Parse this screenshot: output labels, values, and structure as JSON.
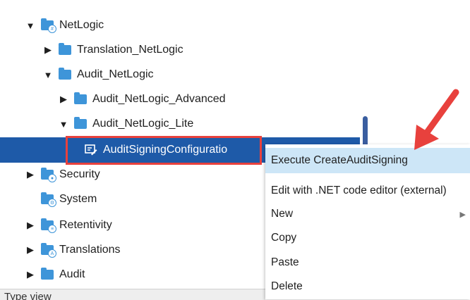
{
  "tree": {
    "items": [
      {
        "label": "NetLogic",
        "icon": "netlogic-folder-icon",
        "expander": "expanded"
      },
      {
        "label": "Translation_NetLogic",
        "icon": "folder-icon",
        "expander": "collapsed"
      },
      {
        "label": "Audit_NetLogic",
        "icon": "folder-icon",
        "expander": "expanded"
      },
      {
        "label": "Audit_NetLogic_Advanced",
        "icon": "folder-icon",
        "expander": "collapsed"
      },
      {
        "label": "Audit_NetLogic_Lite",
        "icon": "folder-icon",
        "expander": "expanded"
      },
      {
        "label": "AuditSigningConfiguratio",
        "icon": "script-icon",
        "selected": true
      },
      {
        "label": "Security",
        "icon": "security-folder-icon",
        "expander": "collapsed"
      },
      {
        "label": "System",
        "icon": "system-folder-icon"
      },
      {
        "label": "Retentivity",
        "icon": "retentivity-folder-icon",
        "expander": "collapsed"
      },
      {
        "label": "Translations",
        "icon": "translations-folder-icon",
        "expander": "collapsed"
      },
      {
        "label": "Audit",
        "icon": "folder-icon",
        "expander": "collapsed"
      }
    ]
  },
  "context_menu": {
    "items": [
      {
        "label": "Execute CreateAuditSigning",
        "highlighted": true
      },
      {
        "label": "Edit with .NET code editor (external)"
      },
      {
        "label": "New",
        "has_submenu": true
      },
      {
        "label": "Copy"
      },
      {
        "label": "Paste"
      },
      {
        "label": "Delete"
      }
    ]
  },
  "bottom_panel": {
    "title": "Type view"
  },
  "colors": {
    "selection": "#1e5aa8",
    "menu_highlight": "#cde6f7",
    "annotation": "#e8413d",
    "folder": "#3e95d9"
  }
}
